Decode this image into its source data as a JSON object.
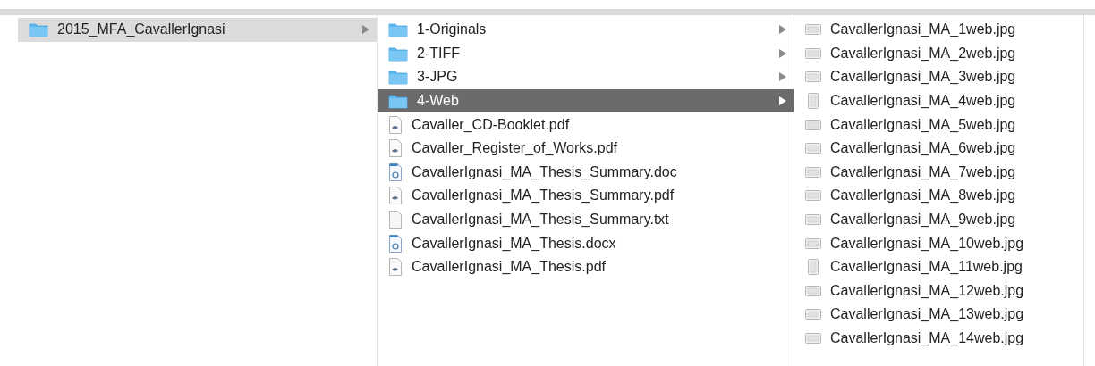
{
  "columns": [
    {
      "focused": false,
      "items": [
        {
          "name": "2015_MFA_CavallerIgnasi",
          "kind": "folder",
          "selected": true
        }
      ]
    },
    {
      "focused": true,
      "items": [
        {
          "name": "1-Originals",
          "kind": "folder",
          "selected": false
        },
        {
          "name": "2-TIFF",
          "kind": "folder",
          "selected": false
        },
        {
          "name": "3-JPG",
          "kind": "folder",
          "selected": false
        },
        {
          "name": "4-Web",
          "kind": "folder",
          "selected": true
        },
        {
          "name": "Cavaller_CD-Booklet.pdf",
          "kind": "pdf",
          "selected": false
        },
        {
          "name": "Cavaller_Register_of_Works.pdf",
          "kind": "pdf",
          "selected": false
        },
        {
          "name": "CavallerIgnasi_MA_Thesis_Summary.doc",
          "kind": "word",
          "selected": false
        },
        {
          "name": "CavallerIgnasi_MA_Thesis_Summary.pdf",
          "kind": "pdf",
          "selected": false
        },
        {
          "name": "CavallerIgnasi_MA_Thesis_Summary.txt",
          "kind": "text",
          "selected": false
        },
        {
          "name": "CavallerIgnasi_MA_Thesis.docx",
          "kind": "word",
          "selected": false
        },
        {
          "name": "CavallerIgnasi_MA_Thesis.pdf",
          "kind": "pdf",
          "selected": false
        }
      ]
    },
    {
      "items": [
        {
          "name": "CavallerIgnasi_MA_1web.jpg",
          "kind": "image",
          "selected": false
        },
        {
          "name": "CavallerIgnasi_MA_2web.jpg",
          "kind": "image",
          "selected": false
        },
        {
          "name": "CavallerIgnasi_MA_3web.jpg",
          "kind": "image",
          "selected": false
        },
        {
          "name": "CavallerIgnasi_MA_4web.jpg",
          "kind": "image-portrait",
          "selected": false
        },
        {
          "name": "CavallerIgnasi_MA_5web.jpg",
          "kind": "image",
          "selected": false
        },
        {
          "name": "CavallerIgnasi_MA_6web.jpg",
          "kind": "image",
          "selected": false
        },
        {
          "name": "CavallerIgnasi_MA_7web.jpg",
          "kind": "image",
          "selected": false
        },
        {
          "name": "CavallerIgnasi_MA_8web.jpg",
          "kind": "image",
          "selected": false
        },
        {
          "name": "CavallerIgnasi_MA_9web.jpg",
          "kind": "image",
          "selected": false
        },
        {
          "name": "CavallerIgnasi_MA_10web.jpg",
          "kind": "image",
          "selected": false
        },
        {
          "name": "CavallerIgnasi_MA_11web.jpg",
          "kind": "image-portrait",
          "selected": false
        },
        {
          "name": "CavallerIgnasi_MA_12web.jpg",
          "kind": "image",
          "selected": false
        },
        {
          "name": "CavallerIgnasi_MA_13web.jpg",
          "kind": "image",
          "selected": false
        },
        {
          "name": "CavallerIgnasi_MA_14web.jpg",
          "kind": "image",
          "selected": false
        }
      ]
    }
  ]
}
